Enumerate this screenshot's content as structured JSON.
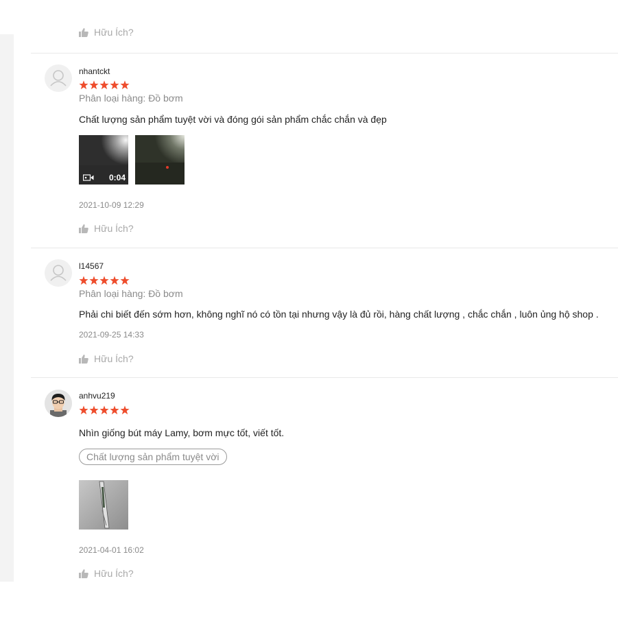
{
  "prev_review": {
    "helpful_label": "Hữu Ích?"
  },
  "reviews": [
    {
      "username": "nhantckt",
      "rating": 5,
      "variation": "Phân loại hàng: Đồ bơm",
      "comment": "Chất lượng sản phẩm tuyệt vời và đóng gói sản phẩm chắc chắn và đẹp",
      "video_duration": "0:04",
      "timestamp": "2021-10-09 12:29",
      "helpful_label": "Hữu Ích?"
    },
    {
      "username": "l14567",
      "rating": 5,
      "variation": "Phân loại hàng: Đồ bơm",
      "comment": "Phải chi biết đến sớm hơn, không nghĩ nó có tồn tại nhưng vậy là đủ rồi, hàng chất lượng , chắc chắn , luôn ủng hộ shop .",
      "timestamp": "2021-09-25 14:33",
      "helpful_label": "Hữu Ích?"
    },
    {
      "username": "anhvu219",
      "rating": 5,
      "comment": "Nhìn giống bút máy Lamy, bơm mực tốt, viết tốt.",
      "tag": "Chất lượng sản phẩm tuyệt vời",
      "timestamp": "2021-04-01 16:02",
      "helpful_label": "Hữu Ích?"
    }
  ],
  "colors": {
    "star": "#ee4d2d",
    "muted_text": "#8a8a8a",
    "divider": "#e8e8e8"
  },
  "icons": {
    "thumbs_up": "thumbs-up-icon",
    "star": "star-icon",
    "default_avatar": "user-icon",
    "video": "video-camera-icon"
  }
}
